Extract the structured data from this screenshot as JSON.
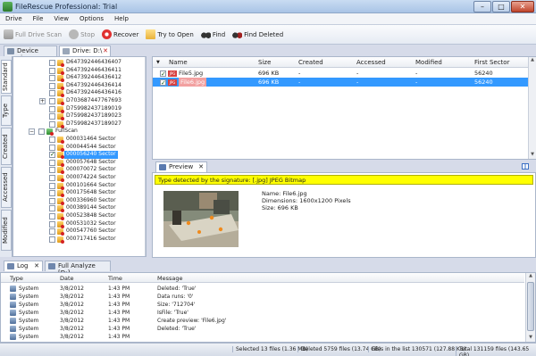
{
  "window": {
    "title": "FileRescue Professional: Trial",
    "min": "–",
    "max": "□",
    "close": "✕"
  },
  "menu": [
    "Drive",
    "File",
    "View",
    "Options",
    "Help"
  ],
  "toolbar": {
    "full_drive_scan": "Full Drive Scan",
    "stop": "Stop",
    "recover": "Recover",
    "try_to_open": "Try to Open",
    "find": "Find",
    "find_deleted": "Find Deleted"
  },
  "top_tabs": {
    "device_view": "Device view",
    "drive": "Drive: D:\\"
  },
  "side_tabs": [
    "Standard",
    "Type",
    "Created",
    "Accessed",
    "Modified"
  ],
  "tree": {
    "items_top": [
      "D647392446436407",
      "D647392446436411",
      "D647392446436412",
      "D647392446436414",
      "D647392446436416",
      "D703687447767693",
      "D759982437189019",
      "D759982437189023",
      "D759982437189027"
    ],
    "full_scan": "FullScan",
    "sectors": [
      "000031464 Sector",
      "000044544 Sector",
      "000056240 Sector",
      "000057648 Sector",
      "000070072 Sector",
      "000074224 Sector",
      "000101664 Sector",
      "000175648 Sector",
      "000336960 Sector",
      "000389144 Sector",
      "000523848 Sector",
      "000531032 Sector",
      "000547760 Sector",
      "000717416 Sector"
    ],
    "selected_sector": "000056240 Sector"
  },
  "file_list": {
    "columns": [
      "Name",
      "Size",
      "Created",
      "Accessed",
      "Modified",
      "First Sector"
    ],
    "rows": [
      {
        "name": "File5.jpg",
        "size": "696 KB",
        "created": "-",
        "accessed": "-",
        "modified": "-",
        "first_sector": "56240"
      },
      {
        "name": "File6.jpg",
        "size": "696 KB",
        "created": "-",
        "accessed": "-",
        "modified": "-",
        "first_sector": "56240"
      }
    ]
  },
  "preview": {
    "tab": "Preview",
    "close": "✕",
    "detected": "Type detected by the signature: [.jpg] JPEG Bitmap",
    "name": "Name: File6.jpg",
    "dimensions": "Dimensions: 1600x1200 Pixels",
    "size": "Size: 696 KB"
  },
  "log_tabs": {
    "log": "Log",
    "full_analyze": "Full Analyze [D:]"
  },
  "log": {
    "columns": [
      "Type",
      "Date",
      "Time",
      "Message"
    ],
    "rows": [
      {
        "type": "System",
        "date": "3/8/2012",
        "time": "1:43 PM",
        "message": "Deleted: 'True'"
      },
      {
        "type": "System",
        "date": "3/8/2012",
        "time": "1:43 PM",
        "message": "Data runs: '0'"
      },
      {
        "type": "System",
        "date": "3/8/2012",
        "time": "1:43 PM",
        "message": "Size: '712704'"
      },
      {
        "type": "System",
        "date": "3/8/2012",
        "time": "1:43 PM",
        "message": "IsFile: 'True'"
      },
      {
        "type": "System",
        "date": "3/8/2012",
        "time": "1:43 PM",
        "message": "Create preview: 'File6.jpg'"
      },
      {
        "type": "System",
        "date": "3/8/2012",
        "time": "1:43 PM",
        "message": "Deleted: 'True'"
      },
      {
        "type": "System",
        "date": "3/8/2012",
        "time": "1:43 PM",
        "message": ""
      }
    ]
  },
  "status": {
    "selected": "Selected 13 files (1.36 MB)",
    "deleted": "Deleted 5759 files (13.74 GB)",
    "in_list": "Files in the list 130571 (127.88 KB)",
    "total": "Total 131159 files (143.65 GB)"
  }
}
